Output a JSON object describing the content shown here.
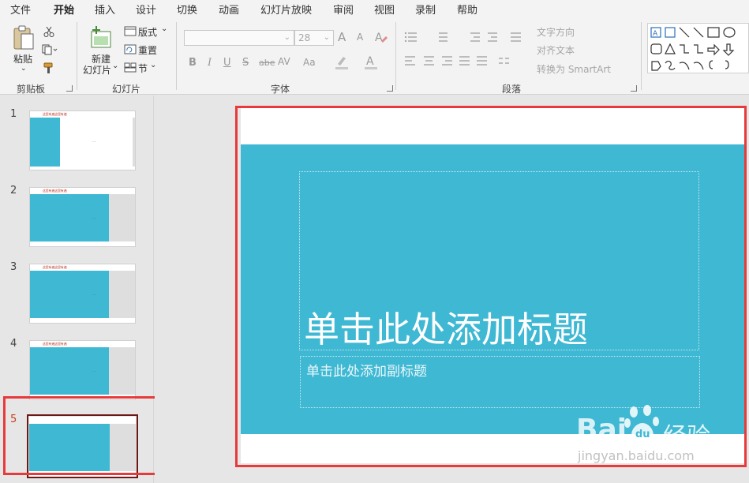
{
  "menu": {
    "tabs": [
      "文件",
      "开始",
      "插入",
      "设计",
      "切换",
      "动画",
      "幻灯片放映",
      "审阅",
      "视图",
      "录制",
      "帮助"
    ],
    "active": "开始"
  },
  "ribbon": {
    "clipboard": {
      "paste": "粘贴",
      "group": "剪贴板"
    },
    "slides": {
      "new_line1": "新建",
      "new_line2": "幻灯片",
      "layout": "版式",
      "reset": "重置",
      "section": "节",
      "group": "幻灯片"
    },
    "font": {
      "font_size": "28",
      "grow": "A",
      "shrink": "A",
      "bold": "B",
      "italic": "I",
      "underline": "U",
      "strike": "S",
      "shadow": "abe",
      "spacing": "AV",
      "case": "Aa",
      "color": "A",
      "group": "字体"
    },
    "paragraph": {
      "text_direction": "文字方向",
      "align_text": "对齐文本",
      "smartart": "转换为 SmartArt",
      "group": "段落"
    }
  },
  "thumbnails": {
    "items": [
      {
        "number": "1",
        "caption": "这里有遍这里有遍"
      },
      {
        "number": "2",
        "caption": "这里有遍这里有遍"
      },
      {
        "number": "3",
        "caption": "这里有遍这里有遍"
      },
      {
        "number": "4",
        "caption": "这里有遍这里有遍"
      },
      {
        "number": "5",
        "caption": ""
      }
    ],
    "selected": "5"
  },
  "slide": {
    "title_placeholder": "单击此处添加标题",
    "subtitle_placeholder": "单击此处添加副标题",
    "band_color": "#3fb8d3"
  },
  "watermark": {
    "brand_left": "Bai",
    "brand_right": "经验",
    "url": "jingyan.baidu.com"
  },
  "colors": {
    "accent": "#c43e1c",
    "highlight_frame": "#e83a3a"
  }
}
